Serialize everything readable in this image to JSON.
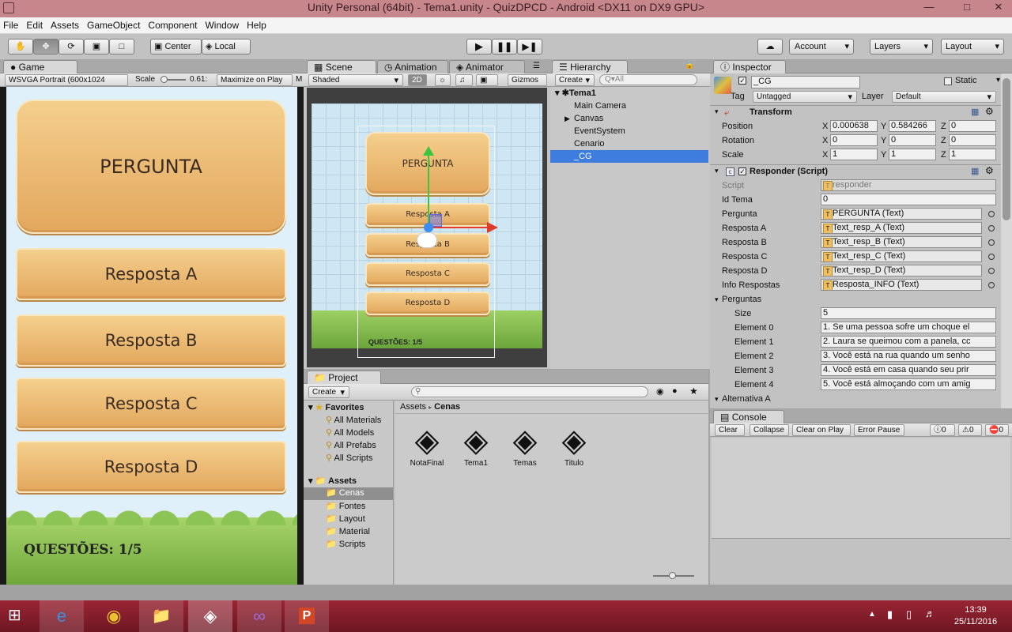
{
  "window": {
    "title": "Unity Personal (64bit) - Tema1.unity - QuizDPCD - Android <DX11 on DX9 GPU>",
    "minimize": "—",
    "maximize": "□",
    "close": "✕"
  },
  "menu": [
    "File",
    "Edit",
    "Assets",
    "GameObject",
    "Component",
    "Window",
    "Help"
  ],
  "toolbar": {
    "center": "Center",
    "local": "Local",
    "account": "Account",
    "layers": "Layers",
    "layout": "Layout"
  },
  "game": {
    "tab": "Game",
    "resolution": "WSVGA Portrait (600x1024",
    "scale_label": "Scale",
    "scale_value": "0.61:",
    "maximize": "Maximize on Play",
    "m": "M",
    "question": "PERGUNTA",
    "answers": [
      "Resposta A",
      "Resposta B",
      "Resposta C",
      "Resposta D"
    ],
    "counter": "QUESTÕES: 1/5"
  },
  "scene": {
    "tab": "Scene",
    "tab2": "Animation",
    "tab3": "Animator",
    "shaded": "Shaded",
    "mode2d": "2D",
    "gizmos": "Gizmos",
    "question": "PERGUNTA",
    "answers": [
      "Resposta A",
      "Resposta B",
      "Resposta C",
      "Resposta D"
    ],
    "counter": "QUESTÕES: 1/5"
  },
  "hierarchy": {
    "tab": "Hierarchy",
    "create": "Create",
    "search_placeholder": "Q▾All",
    "scene": "Tema1",
    "items": [
      "Main Camera",
      "Canvas",
      "EventSystem",
      "Cenario",
      "_CG"
    ]
  },
  "inspector": {
    "tab": "Inspector",
    "name": "_CG",
    "static": "Static",
    "tag_label": "Tag",
    "tag": "Untagged",
    "layer_label": "Layer",
    "layer": "Default",
    "transform": {
      "title": "Transform",
      "rows": [
        {
          "label": "Position",
          "x": "0.000638",
          "y": "0.584266",
          "z": "0"
        },
        {
          "label": "Rotation",
          "x": "0",
          "y": "0",
          "z": "0"
        },
        {
          "label": "Scale",
          "x": "1",
          "y": "1",
          "z": "1"
        }
      ]
    },
    "script": {
      "title": "Responder (Script)",
      "script_label": "Script",
      "script_value": "responder",
      "id_label": "Id Tema",
      "id_value": "0",
      "refs": [
        {
          "label": "Pergunta",
          "value": "PERGUNTA (Text)"
        },
        {
          "label": "Resposta A",
          "value": "Text_resp_A (Text)"
        },
        {
          "label": "Resposta B",
          "value": "Text_resp_B (Text)"
        },
        {
          "label": "Resposta C",
          "value": "Text_resp_C (Text)"
        },
        {
          "label": "Resposta D",
          "value": "Text_resp_D (Text)"
        },
        {
          "label": "Info Respostas",
          "value": "Resposta_INFO (Text)"
        }
      ],
      "perguntas_label": "Perguntas",
      "size_label": "Size",
      "size_value": "5",
      "elements": [
        {
          "label": "Element 0",
          "value": "1. Se uma pessoa sofre um choque el"
        },
        {
          "label": "Element 1",
          "value": "2. Laura se queimou com a panela, cc"
        },
        {
          "label": "Element 2",
          "value": "3. Você está na rua quando um senho"
        },
        {
          "label": "Element 3",
          "value": "4. Você está em casa quando seu prir"
        },
        {
          "label": "Element 4",
          "value": "5. Você está almoçando com um amig"
        }
      ],
      "alt_label": "Alternativa A"
    }
  },
  "console": {
    "tab": "Console",
    "buttons": [
      "Clear",
      "Collapse",
      "Clear on Play",
      "Error Pause"
    ],
    "counts": [
      "0",
      "0",
      "0"
    ]
  },
  "project": {
    "tab": "Project",
    "create": "Create",
    "favorites_label": "Favorites",
    "favorites": [
      "All Materials",
      "All Models",
      "All Prefabs",
      "All Scripts"
    ],
    "assets_label": "Assets",
    "folders": [
      "Cenas",
      "Fontes",
      "Layout",
      "Material",
      "Scripts"
    ],
    "breadcrumb_root": "Assets",
    "breadcrumb_sep": "▸",
    "breadcrumb_current": "Cenas",
    "files": [
      "NotaFinal",
      "Tema1",
      "Temas",
      "Titulo"
    ]
  },
  "taskbar": {
    "time": "13:39",
    "date": "25/11/2016",
    "colors": {
      "bar": "#8a1d2c",
      "accent": "#3e8ede"
    }
  }
}
